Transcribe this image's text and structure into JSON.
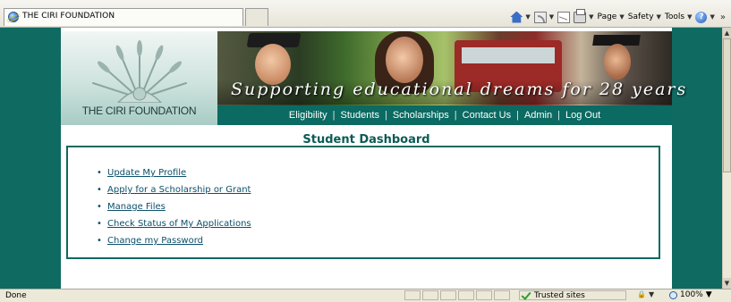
{
  "browser": {
    "tab_title": "THE CIRI FOUNDATION",
    "toolbar": {
      "page": "Page",
      "safety": "Safety",
      "tools": "Tools",
      "more": "»"
    },
    "icons": [
      "home-icon",
      "feeds-icon",
      "read-mail-icon",
      "print-icon",
      "help-icon"
    ]
  },
  "header": {
    "logo_text": "THE CIRI FOUNDATION",
    "tagline": "Supporting educational dreams for 28 years",
    "nav": [
      {
        "label": "Eligibility"
      },
      {
        "label": "Students"
      },
      {
        "label": "Scholarships"
      },
      {
        "label": "Contact Us"
      },
      {
        "label": "Admin"
      },
      {
        "label": "Log Out"
      }
    ],
    "nav_separator": "|"
  },
  "dashboard": {
    "title": "Student Dashboard",
    "links": [
      "Update My Profile",
      "Apply for a Scholarship or Grant",
      "Manage Files",
      "Check Status of My Applications",
      "Change my Password"
    ]
  },
  "status_bar": {
    "status": "Done",
    "zone": "Trusted sites",
    "zoom": "100%"
  },
  "colors": {
    "brand_teal": "#0b6a62",
    "page_bg": "#0f6a62",
    "link": "#0b4f6a"
  }
}
